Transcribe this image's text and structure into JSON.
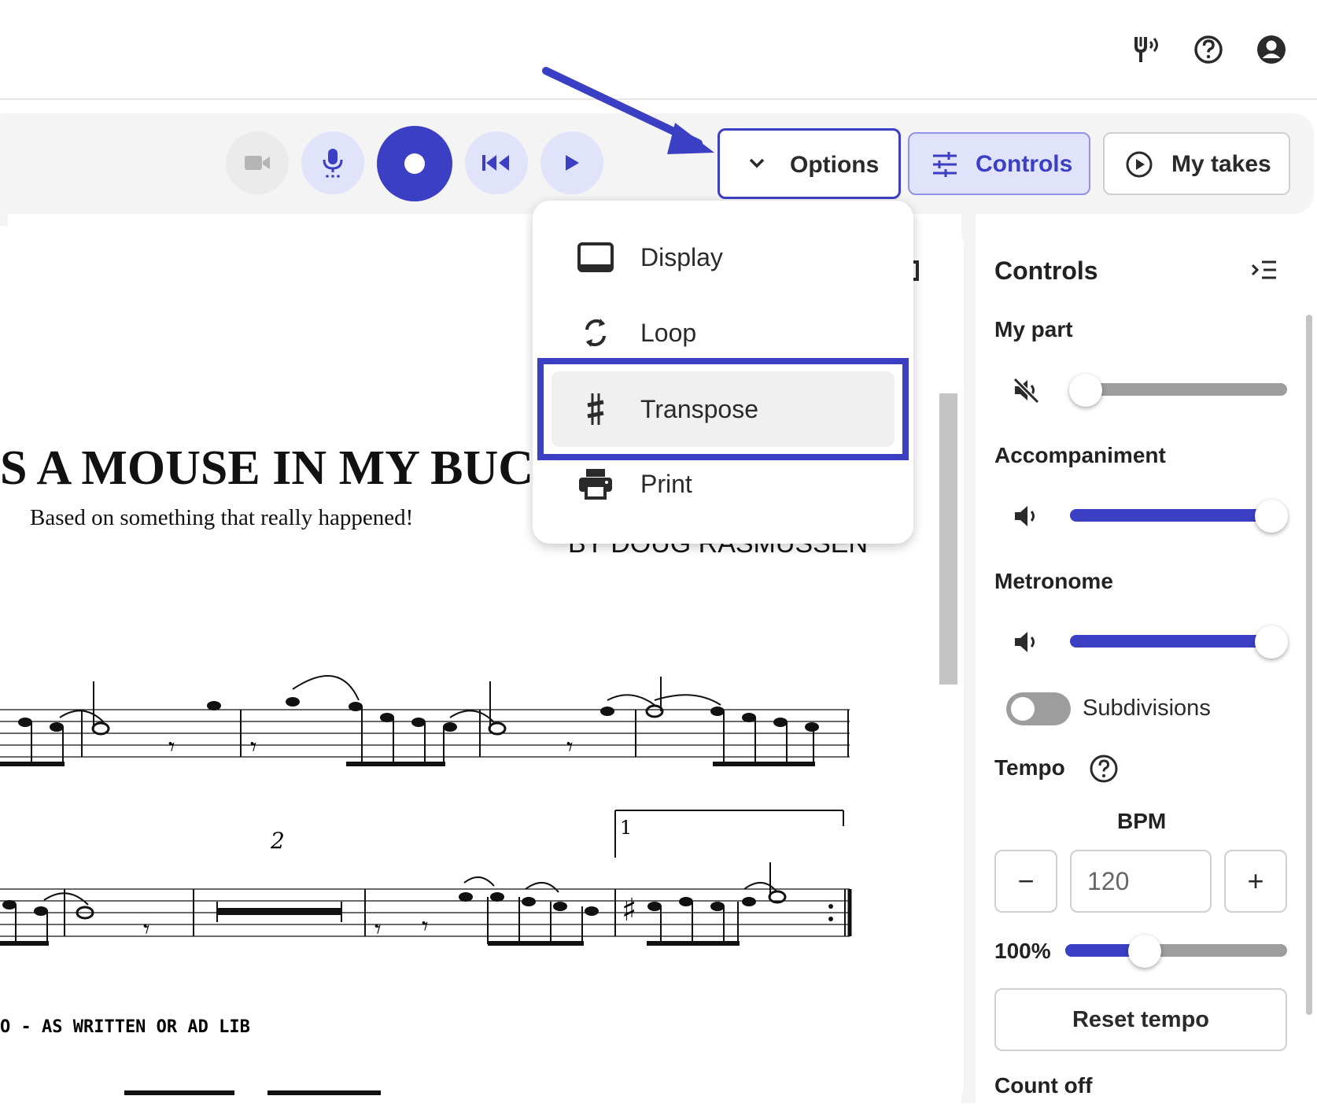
{
  "header": {
    "icons": [
      "tuner-icon",
      "help-icon",
      "account-icon"
    ]
  },
  "toolbar": {
    "camera": "camera-icon",
    "mic": "microphone-icon",
    "record": "record-icon",
    "rewind": "skip-back-icon",
    "play": "play-icon",
    "options_label": "Options",
    "controls_label": "Controls",
    "takes_label": "My takes",
    "accent": "#3b3fc4"
  },
  "options_menu": {
    "items": [
      {
        "label": "Display",
        "icon": "display-icon"
      },
      {
        "label": "Loop",
        "icon": "loop-icon"
      },
      {
        "label": "Transpose",
        "icon": "sharp-icon"
      },
      {
        "label": "Print",
        "icon": "print-icon"
      }
    ],
    "highlighted": "Transpose"
  },
  "score": {
    "title": "S A MOUSE IN MY BUCK",
    "subtitle": "Based on something that really happened!",
    "composer": "BY DOUG RASMUSSEN",
    "measure_rest": "2",
    "ending": "1",
    "section_text": "O - AS WRITTEN OR AD LIB"
  },
  "controls": {
    "title": "Controls",
    "my_part": {
      "label": "My part",
      "level": 0.0,
      "muted": true
    },
    "accompaniment": {
      "label": "Accompaniment",
      "level": 1.0
    },
    "metronome": {
      "label": "Metronome",
      "level": 1.0
    },
    "subdivisions": {
      "label": "Subdivisions",
      "on": false
    },
    "tempo": {
      "label": "Tempo",
      "bpm_label": "BPM",
      "bpm_value": "120",
      "minus": "−",
      "plus": "+",
      "percent": "100%",
      "percent_level": 0.36,
      "reset_label": "Reset tempo"
    },
    "count_off": "Count off"
  }
}
